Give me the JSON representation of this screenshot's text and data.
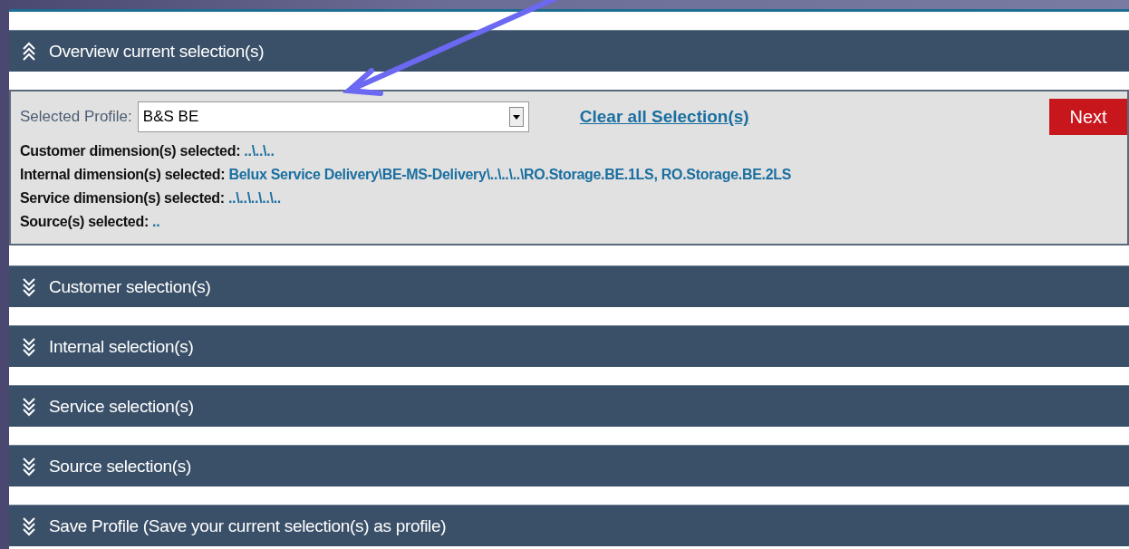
{
  "sections": [
    {
      "title": "Overview current selection(s)",
      "expanded": true,
      "panel": {
        "profile_label": "Selected Profile:",
        "profile_value": "B&S BE",
        "clear_link": "Clear all Selection(s)",
        "next_button": "Next",
        "lines": [
          {
            "heading": "Customer dimension(s) selected:",
            "path": "..\\..\\.."
          },
          {
            "heading": "Internal dimension(s) selected:",
            "path": "Belux Service Delivery\\BE-MS-Delivery\\..\\..\\..\\RO.Storage.BE.1LS, RO.Storage.BE.2LS"
          },
          {
            "heading": "Service dimension(s) selected:",
            "path": "..\\..\\..\\..\\.."
          },
          {
            "heading": "Source(s) selected:",
            "path": ".."
          }
        ]
      }
    },
    {
      "title": "Customer selection(s)",
      "expanded": false
    },
    {
      "title": "Internal selection(s)",
      "expanded": false
    },
    {
      "title": "Service selection(s)",
      "expanded": false
    },
    {
      "title": "Source selection(s)",
      "expanded": false
    },
    {
      "title": "Save Profile (Save your current selection(s) as profile)",
      "expanded": false
    }
  ]
}
